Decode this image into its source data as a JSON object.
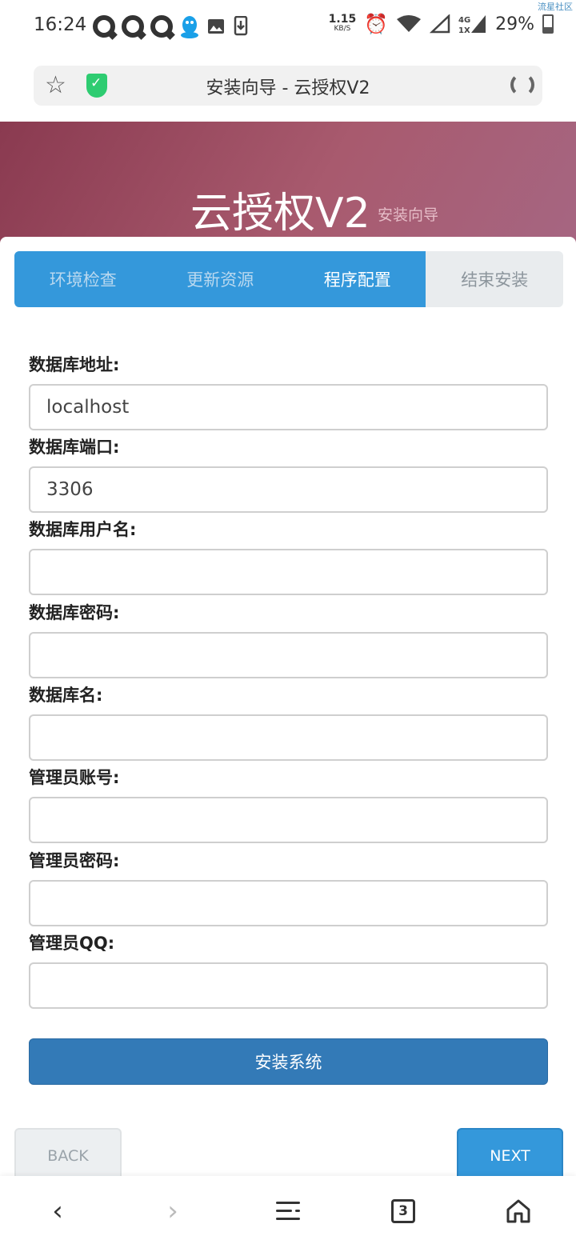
{
  "status_bar": {
    "time": "16:24",
    "net_speed": "1.15",
    "net_unit": "KB/S",
    "signal_label": "4G 1X",
    "battery": "29%",
    "watermark": "流星社区"
  },
  "browser": {
    "page_title": "安装向导 - 云授权V2",
    "tab_count": "3"
  },
  "header": {
    "brand": "云授权V2",
    "subtitle": "安装向导"
  },
  "steps": [
    {
      "label": "环境检查",
      "state": "done"
    },
    {
      "label": "更新资源",
      "state": "done"
    },
    {
      "label": "程序配置",
      "state": "current"
    },
    {
      "label": "结束安装",
      "state": "todo"
    }
  ],
  "form": {
    "fields": [
      {
        "label": "数据库地址:",
        "value": "localhost"
      },
      {
        "label": "数据库端口:",
        "value": "3306"
      },
      {
        "label": "数据库用户名:",
        "value": ""
      },
      {
        "label": "数据库密码:",
        "value": ""
      },
      {
        "label": "数据库名:",
        "value": ""
      },
      {
        "label": "管理员账号:",
        "value": ""
      },
      {
        "label": "管理员密码:",
        "value": ""
      },
      {
        "label": "管理员QQ:",
        "value": ""
      }
    ],
    "submit_label": "安装系统"
  },
  "wizard_nav": {
    "back_label": "BACK",
    "next_label": "NEXT"
  },
  "colors": {
    "accent": "#3498db",
    "install_button": "#337ab7",
    "banner": "#a85a6e",
    "shield": "#2ecc71"
  }
}
